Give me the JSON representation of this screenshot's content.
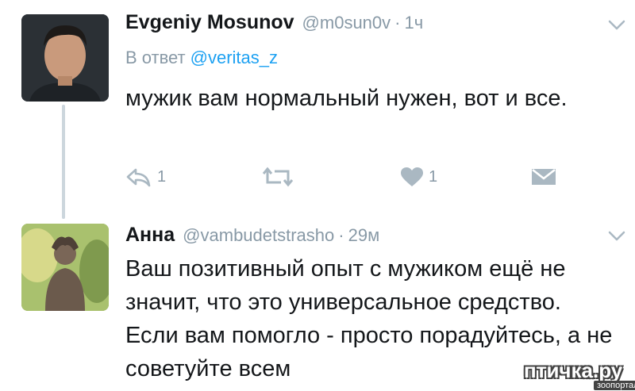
{
  "tweet1": {
    "name": "Evgeniy Mosunov",
    "handle": "@m0sun0v",
    "time": "1ч",
    "reply_prefix": "В ответ",
    "reply_to": "@veritas_z",
    "text": "мужик вам нормальный нужен, вот и все.",
    "reply_count": "1",
    "like_count": "1",
    "icons": [
      "reply-icon",
      "retweet-icon",
      "heart-icon",
      "message-icon",
      "chevron-down-icon"
    ]
  },
  "tweet2": {
    "name": "Анна",
    "handle": "@vambudetstrasho",
    "time": "29м",
    "text": "Ваш позитивный опыт с мужиком ещё не значит, что это универсальное средство. Если вам помогло - просто порадуйтесь, а не советуйте всем"
  },
  "watermark": {
    "main": "птичка.ру",
    "sub": "зоопортал"
  },
  "colors": {
    "muted": "#8899a6",
    "link": "#1da1f2",
    "text": "#14171a",
    "thread_line": "#ccd6dd"
  }
}
